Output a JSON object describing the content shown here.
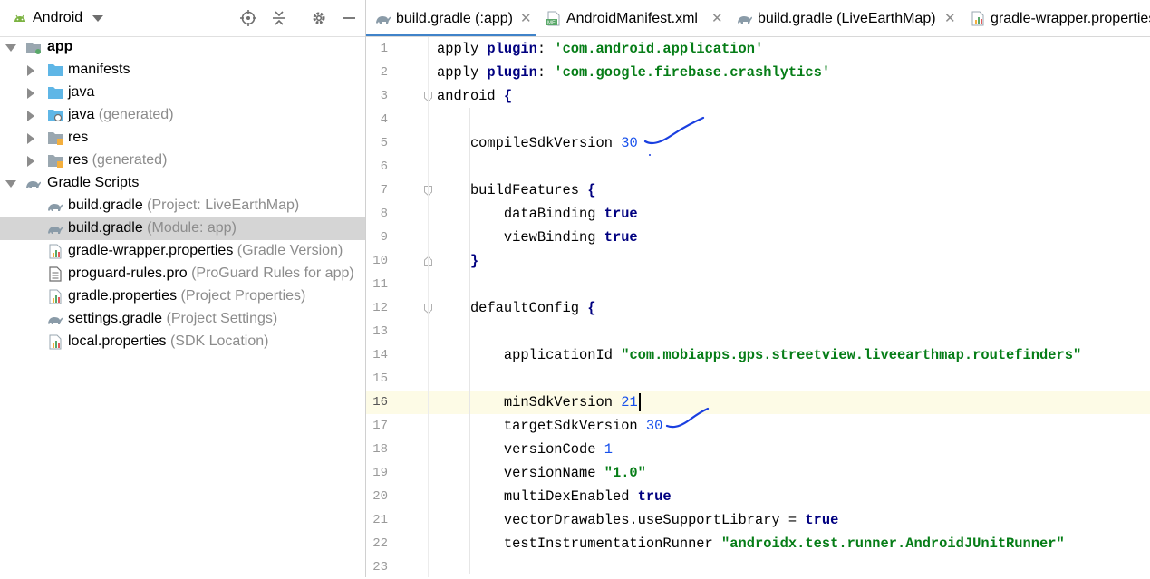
{
  "project_panel": {
    "title": "Android",
    "tree": [
      {
        "label": "app",
        "hint": "",
        "bold": true,
        "icon": "module-folder-icon",
        "arrow": "down",
        "level": 0
      },
      {
        "label": "manifests",
        "hint": "",
        "icon": "folder-icon",
        "arrow": "right",
        "level": 1
      },
      {
        "label": "java",
        "hint": "",
        "icon": "folder-icon",
        "arrow": "right",
        "level": 1
      },
      {
        "label": "java",
        "hint": "(generated)",
        "icon": "generated-folder-icon",
        "arrow": "right",
        "level": 1
      },
      {
        "label": "res",
        "hint": "",
        "icon": "res-folder-icon",
        "arrow": "right",
        "level": 1
      },
      {
        "label": "res",
        "hint": "(generated)",
        "icon": "res-folder-icon",
        "arrow": "right",
        "level": 1
      },
      {
        "label": "Gradle Scripts",
        "hint": "",
        "icon": "gradle-icon",
        "arrow": "down",
        "level": 0
      },
      {
        "label": "build.gradle",
        "hint": "(Project: LiveEarthMap)",
        "icon": "gradle-file-icon",
        "arrow": "",
        "level": 1
      },
      {
        "label": "build.gradle",
        "hint": "(Module: app)",
        "icon": "gradle-file-icon",
        "arrow": "",
        "level": 1,
        "selected": true
      },
      {
        "label": "gradle-wrapper.properties",
        "hint": "(Gradle Version)",
        "icon": "properties-file-icon",
        "arrow": "",
        "level": 1
      },
      {
        "label": "proguard-rules.pro",
        "hint": "(ProGuard Rules for app)",
        "icon": "text-file-icon",
        "arrow": "",
        "level": 1
      },
      {
        "label": "gradle.properties",
        "hint": "(Project Properties)",
        "icon": "properties-file-icon",
        "arrow": "",
        "level": 1
      },
      {
        "label": "settings.gradle",
        "hint": "(Project Settings)",
        "icon": "gradle-file-icon",
        "arrow": "",
        "level": 1
      },
      {
        "label": "local.properties",
        "hint": "(SDK Location)",
        "icon": "properties-file-icon",
        "arrow": "",
        "level": 1
      }
    ]
  },
  "tabs": [
    {
      "label": "build.gradle (:app)",
      "icon": "gradle-file-icon",
      "active": true
    },
    {
      "label": "AndroidManifest.xml",
      "icon": "manifest-file-icon",
      "active": false
    },
    {
      "label": "build.gradle (LiveEarthMap)",
      "icon": "gradle-file-icon",
      "active": false
    },
    {
      "label": "gradle-wrapper.properties",
      "icon": "properties-file-icon",
      "active": false
    }
  ],
  "editor": {
    "current_line": 16,
    "lines": [
      [
        {
          "t": "apply ",
          "c": "plain"
        },
        {
          "t": "plugin",
          "c": "kw"
        },
        {
          "t": ": ",
          "c": "plain"
        },
        {
          "t": "'com.android.application'",
          "c": "str"
        }
      ],
      [
        {
          "t": "apply ",
          "c": "plain"
        },
        {
          "t": "plugin",
          "c": "kw"
        },
        {
          "t": ": ",
          "c": "plain"
        },
        {
          "t": "'com.google.firebase.crashlytics'",
          "c": "str"
        }
      ],
      [
        {
          "t": "android ",
          "c": "plain"
        },
        {
          "t": "{",
          "c": "kw"
        }
      ],
      [],
      [
        {
          "t": "    compileSdkVersion ",
          "c": "plain"
        },
        {
          "t": "30",
          "c": "num"
        }
      ],
      [],
      [
        {
          "t": "    buildFeatures ",
          "c": "plain"
        },
        {
          "t": "{",
          "c": "kw"
        }
      ],
      [
        {
          "t": "        dataBinding ",
          "c": "plain"
        },
        {
          "t": "true",
          "c": "kw"
        }
      ],
      [
        {
          "t": "        viewBinding ",
          "c": "plain"
        },
        {
          "t": "true",
          "c": "kw"
        }
      ],
      [
        {
          "t": "    ",
          "c": "plain"
        },
        {
          "t": "}",
          "c": "kw"
        }
      ],
      [],
      [
        {
          "t": "    defaultConfig ",
          "c": "plain"
        },
        {
          "t": "{",
          "c": "kw"
        }
      ],
      [],
      [
        {
          "t": "        applicationId ",
          "c": "plain"
        },
        {
          "t": "\"com.mobiapps.gps.streetview.liveearthmap.routefinders\"",
          "c": "str"
        }
      ],
      [],
      [
        {
          "t": "        minSdkVersion ",
          "c": "plain"
        },
        {
          "t": "21",
          "c": "num"
        }
      ],
      [
        {
          "t": "        targetSdkVersion ",
          "c": "plain"
        },
        {
          "t": "30",
          "c": "num"
        }
      ],
      [
        {
          "t": "        versionCode ",
          "c": "plain"
        },
        {
          "t": "1",
          "c": "num"
        }
      ],
      [
        {
          "t": "        versionName ",
          "c": "plain"
        },
        {
          "t": "\"1.0\"",
          "c": "str"
        }
      ],
      [
        {
          "t": "        multiDexEnabled ",
          "c": "plain"
        },
        {
          "t": "true",
          "c": "kw"
        }
      ],
      [
        {
          "t": "        vectorDrawables.useSupportLibrary = ",
          "c": "plain"
        },
        {
          "t": "true",
          "c": "kw"
        }
      ],
      [
        {
          "t": "        testInstrumentationRunner ",
          "c": "plain"
        },
        {
          "t": "\"androidx.test.runner.AndroidJUnitRunner\"",
          "c": "str"
        }
      ],
      []
    ]
  },
  "colors": {
    "accent": "#4083c9",
    "keyword": "#000080",
    "string": "#067d17",
    "number": "#1750eb",
    "selection": "#d5d5d5",
    "current_line": "#fdfbe6",
    "annotation": "#1a3fe0"
  }
}
